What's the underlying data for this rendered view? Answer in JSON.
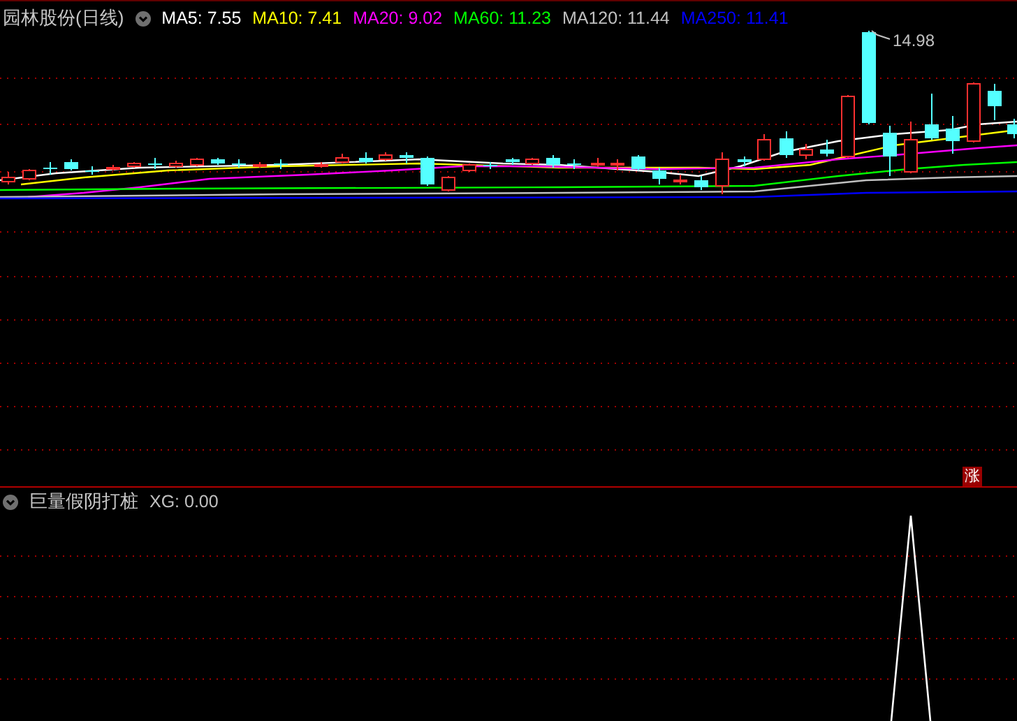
{
  "main_panel": {
    "title": "园林股份(日线)",
    "indicators": [
      {
        "label": "MA5: 7.55",
        "color": "#ffffff"
      },
      {
        "label": "MA10: 7.41",
        "color": "#ffff00"
      },
      {
        "label": "MA20: 9.02",
        "color": "#ff00ff"
      },
      {
        "label": "MA60: 11.23",
        "color": "#00ff00"
      },
      {
        "label": "MA120: 11.44",
        "color": "#c0c0c0"
      },
      {
        "label": "MA250: 11.41",
        "color": "#0000ff"
      }
    ],
    "peak_label": "14.98",
    "badge": "涨"
  },
  "sub_panel": {
    "title": "巨量假阴打桩",
    "indicators": [
      {
        "label": "XG: 0.00",
        "color": "#c0c0c0"
      }
    ]
  }
}
